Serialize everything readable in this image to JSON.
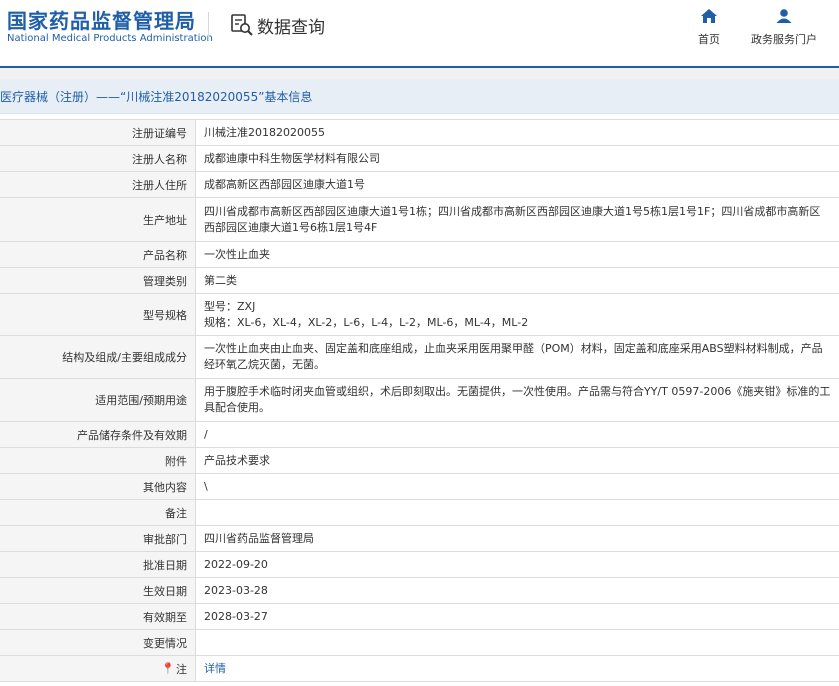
{
  "header": {
    "logo_cn": "国家药品监督管理局",
    "logo_en": "National Medical Products Administration",
    "query_label": "数据查询",
    "nav_home": "首页",
    "nav_portal": "政务服务门户"
  },
  "title": "医疗器械（注册）——“川械注准20182020055”基本信息",
  "rows": [
    {
      "label": "注册证编号",
      "value": "川械注准20182020055"
    },
    {
      "label": "注册人名称",
      "value": "成都迪康中科生物医学材料有限公司"
    },
    {
      "label": "注册人住所",
      "value": "成都高新区西部园区迪康大道1号"
    },
    {
      "label": "生产地址",
      "value": "四川省成都市高新区西部园区迪康大道1号1栋；四川省成都市高新区西部园区迪康大道1号5栋1层1号1F；四川省成都市高新区西部园区迪康大道1号6栋1层1号4F"
    },
    {
      "label": "产品名称",
      "value": "一次性止血夹"
    },
    {
      "label": "管理类别",
      "value": "第二类"
    },
    {
      "label": "型号规格",
      "value": "型号：ZXJ",
      "value2": "规格：XL-6，XL-4，XL-2，L-6，L-4，L-2，ML-6，ML-4，ML-2"
    },
    {
      "label": "结构及组成/主要组成成分",
      "value": "一次性止血夹由止血夹、固定盖和底座组成，止血夹采用医用聚甲醛（POM）材料，固定盖和底座采用ABS塑料材料制成，产品经环氧乙烷灭菌，无菌。"
    },
    {
      "label": "适用范围/预期用途",
      "value": "用于腹腔手术临时闭夹血管或组织，术后即刻取出。无菌提供，一次性使用。产品需与符合YY/T 0597-2006《施夹钳》标准的工具配合使用。"
    },
    {
      "label": "产品储存条件及有效期",
      "value": "/"
    },
    {
      "label": "附件",
      "value": "产品技术要求"
    },
    {
      "label": "其他内容",
      "value": "\\"
    },
    {
      "label": "备注",
      "value": ""
    },
    {
      "label": "审批部门",
      "value": "四川省药品监督管理局"
    },
    {
      "label": "批准日期",
      "value": "2022-09-20"
    },
    {
      "label": "生效日期",
      "value": "2023-03-28"
    },
    {
      "label": "有效期至",
      "value": "2028-03-27"
    },
    {
      "label": "变更情况",
      "value": ""
    },
    {
      "label": "注",
      "value": "详情"
    }
  ]
}
